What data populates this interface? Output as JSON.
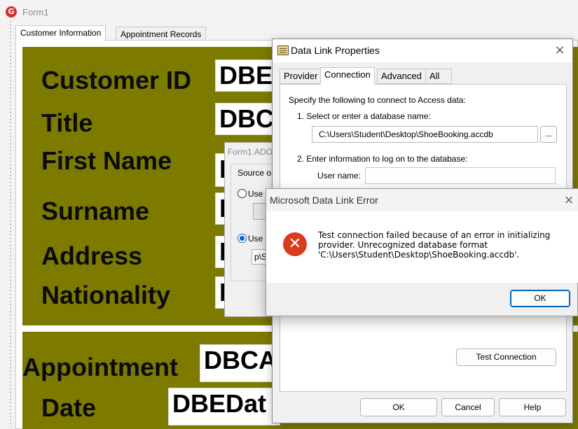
{
  "form": {
    "title": "Form1",
    "tabs": [
      "Customer Information",
      "Appointment Records"
    ],
    "customer_fields": [
      {
        "label": "Customer ID",
        "value": "DBE"
      },
      {
        "label": "Title",
        "value": "DBC"
      },
      {
        "label": "First Name",
        "value": "D"
      },
      {
        "label": "Surname",
        "value": "D"
      },
      {
        "label": "Address",
        "value": "D"
      },
      {
        "label": "Nationality",
        "value": "D"
      }
    ],
    "appointment_label": "Appointment",
    "appointment_value": "DBCA",
    "date_label": "Date",
    "date_value": "DBEDat"
  },
  "ado_form": {
    "title": "Form1.ADO",
    "source_label": "Source o",
    "option1": "Use",
    "option2": "Use",
    "connection_text": "p\\S"
  },
  "data_link": {
    "title": "Data Link Properties",
    "tabs": [
      "Provider",
      "Connection",
      "Advanced",
      "All"
    ],
    "intro": "Specify the following to connect to Access data:",
    "step1": "1. Select or enter a database name:",
    "db_path": "C:\\Users\\Student\\Desktop\\ShoeBooking.accdb",
    "browse_label": "...",
    "step2": "2. Enter information to log on to the database:",
    "user_label": "User name:",
    "test_button": "Test Connection",
    "ok": "OK",
    "cancel": "Cancel",
    "help": "Help"
  },
  "error_dialog": {
    "title": "Microsoft Data Link Error",
    "message": "Test connection failed because of an error in initializing\nprovider. Unrecognized database format\n'C:\\Users\\Student\\Desktop\\ShoeBooking.accdb'.",
    "ok": "OK",
    "close_icon": "×"
  },
  "colors": {
    "panel": "#7d7a00",
    "error_icon": "#d83b1e",
    "accent": "#0067c0"
  }
}
